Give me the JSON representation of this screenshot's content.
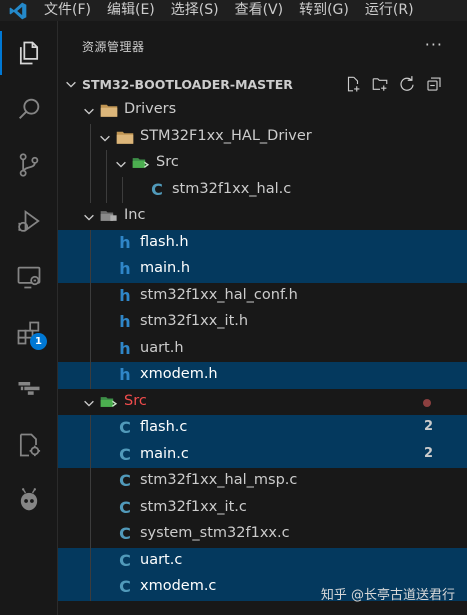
{
  "menu": [
    "文件(F)",
    "编辑(E)",
    "选择(S)",
    "查看(V)",
    "转到(G)",
    "运行(R)"
  ],
  "activity_bar": {
    "items": [
      "explorer-icon",
      "search-icon",
      "source-control-icon",
      "run-debug-icon",
      "remote-explorer-icon",
      "extensions-icon",
      "cmake-icon",
      "remote-settings-icon",
      "platformio-icon"
    ],
    "extensions_badge": "1"
  },
  "sidebar": {
    "title": "资源管理器",
    "more": "···",
    "section_title": "STM32-BOOTLOADER-MASTER",
    "tree": [
      {
        "label": "Drivers",
        "type": "folder",
        "depth": 1,
        "open": true
      },
      {
        "label": "STM32F1xx_HAL_Driver",
        "type": "folder",
        "depth": 2,
        "open": true
      },
      {
        "label": "Src",
        "type": "src-folder",
        "depth": 3,
        "open": true
      },
      {
        "label": "stm32f1xx_hal.c",
        "type": "c",
        "depth": 4
      },
      {
        "label": "Inc",
        "type": "inc-folder",
        "depth": 1,
        "open": true
      },
      {
        "label": "flash.h",
        "type": "h",
        "depth": 2,
        "selected": true
      },
      {
        "label": "main.h",
        "type": "h",
        "depth": 2,
        "selected": true
      },
      {
        "label": "stm32f1xx_hal_conf.h",
        "type": "h",
        "depth": 2
      },
      {
        "label": "stm32f1xx_it.h",
        "type": "h",
        "depth": 2
      },
      {
        "label": "uart.h",
        "type": "h",
        "depth": 2
      },
      {
        "label": "xmodem.h",
        "type": "h",
        "depth": 2,
        "selected": true
      },
      {
        "label": "Src",
        "type": "src-folder",
        "depth": 1,
        "open": true,
        "modified": true
      },
      {
        "label": "flash.c",
        "type": "c",
        "depth": 2,
        "selected": true,
        "count": "2"
      },
      {
        "label": "main.c",
        "type": "c",
        "depth": 2,
        "selected": true,
        "count": "2"
      },
      {
        "label": "stm32f1xx_hal_msp.c",
        "type": "c",
        "depth": 2
      },
      {
        "label": "stm32f1xx_it.c",
        "type": "c",
        "depth": 2
      },
      {
        "label": "system_stm32f1xx.c",
        "type": "c",
        "depth": 2
      },
      {
        "label": "uart.c",
        "type": "c",
        "depth": 2,
        "selected": true
      },
      {
        "label": "xmodem.c",
        "type": "c",
        "depth": 2,
        "selected": true
      }
    ]
  },
  "watermark": "知乎 @长亭古道送君行",
  "colors": {
    "accent": "#0078d4",
    "selection": "#04395e",
    "c_icon": "#519aba",
    "h_icon": "#2f86c8",
    "error": "#f14c4c",
    "folder": "#c09553",
    "src_folder": "#4caf50"
  }
}
